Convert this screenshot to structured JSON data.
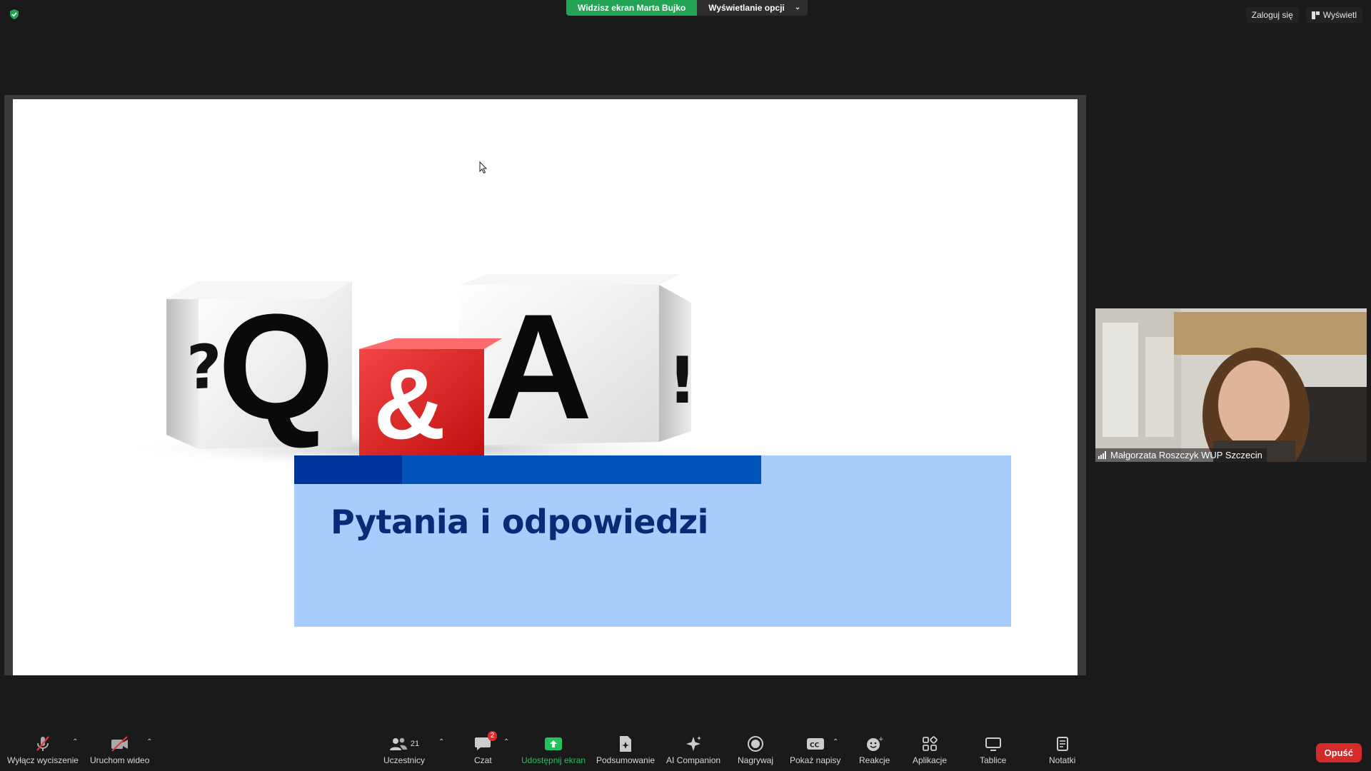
{
  "top": {
    "share_banner": "Widzisz ekran Marta Bujko",
    "view_options": "Wyświetlanie opcji",
    "sign_in": "Zaloguj się",
    "view": "Wyświetl"
  },
  "slide": {
    "dice_letters": [
      "Q",
      "&",
      "A"
    ],
    "title": "Pytania i odpowiedzi"
  },
  "video": {
    "participant_name": "Małgorzata Roszczyk WUP Szczecin"
  },
  "toolbar": {
    "mute": "Wyłącz wyciszenie",
    "video": "Uruchom wideo",
    "participants": "Uczestnicy",
    "participants_count": "21",
    "chat": "Czat",
    "chat_badge": "2",
    "share": "Udostępnij ekran",
    "summary": "Podsumowanie",
    "ai": "AI Companion",
    "record": "Nagrywaj",
    "captions": "Pokaż napisy",
    "reactions": "Reakcje",
    "apps": "Aplikacje",
    "whiteboards": "Tablice",
    "notes": "Notatki",
    "leave": "Opuść"
  },
  "colors": {
    "banner_green": "#23a455",
    "slide_bar_dark": "#003399",
    "slide_bar_mid": "#0054b8",
    "slide_box": "#a8cdfd",
    "slide_title": "#0b2a75",
    "leave_red": "#d42a2a"
  }
}
